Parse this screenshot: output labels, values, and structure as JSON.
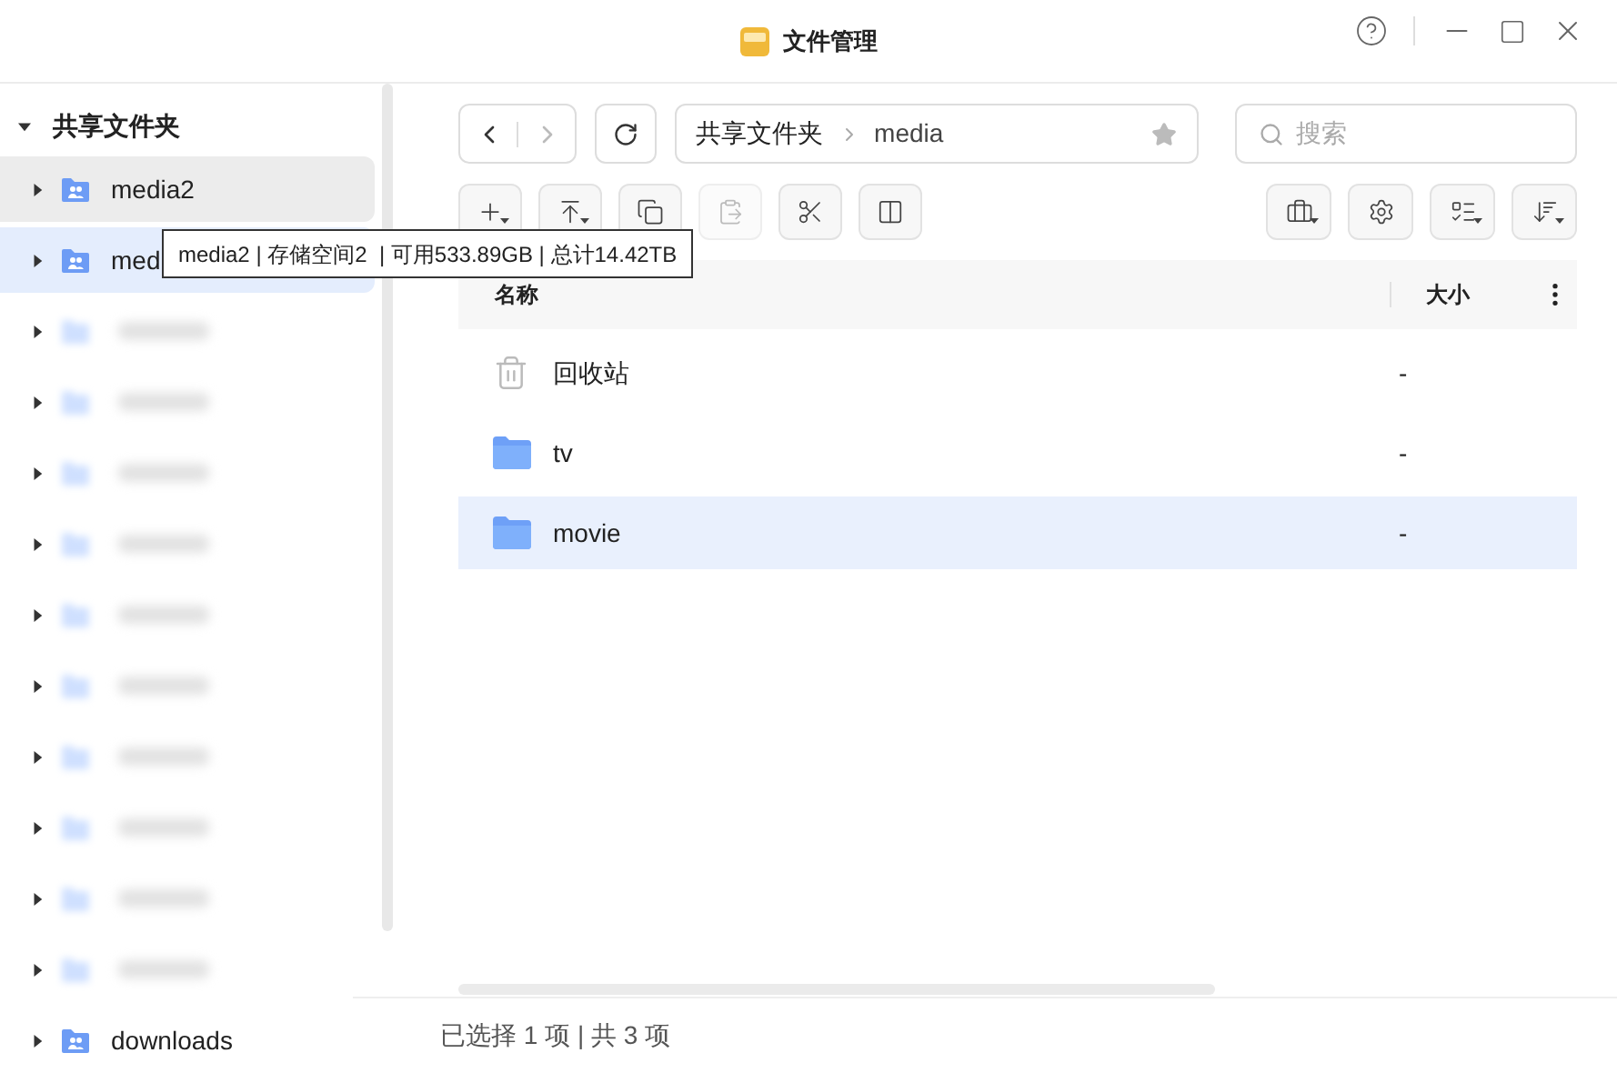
{
  "window": {
    "title": "文件管理"
  },
  "sidebar": {
    "header": "共享文件夹",
    "expanded": true,
    "items": [
      {
        "kind": "share",
        "name": "media2",
        "hovered": true,
        "selected": false
      },
      {
        "kind": "share",
        "name": "med",
        "hovered": false,
        "selected": true
      },
      {
        "kind": "blurred",
        "hovered": false,
        "selected": false
      },
      {
        "kind": "blurred",
        "hovered": false,
        "selected": false
      },
      {
        "kind": "blurred",
        "hovered": false,
        "selected": false
      },
      {
        "kind": "blurred",
        "hovered": false,
        "selected": false
      },
      {
        "kind": "blurred",
        "hovered": false,
        "selected": false
      },
      {
        "kind": "blurred",
        "hovered": false,
        "selected": false
      },
      {
        "kind": "blurred",
        "hovered": false,
        "selected": false
      },
      {
        "kind": "blurred",
        "hovered": false,
        "selected": false
      },
      {
        "kind": "blurred",
        "hovered": false,
        "selected": false
      },
      {
        "kind": "blurred",
        "hovered": false,
        "selected": false
      },
      {
        "kind": "share",
        "name": "downloads",
        "hovered": false,
        "selected": false
      }
    ]
  },
  "tooltip": {
    "text": "media2 | 存储空间2  | 可用533.89GB | 总计14.42TB"
  },
  "nav": {
    "back": {
      "disabled": false
    },
    "forward": {
      "disabled": true
    }
  },
  "breadcrumb": {
    "parts": [
      "共享文件夹",
      "media"
    ],
    "favorite": false
  },
  "search": {
    "placeholder": "搜索"
  },
  "toolbar_left": [
    {
      "kind": "new",
      "disabled": false
    },
    {
      "kind": "upload",
      "disabled": false
    },
    {
      "kind": "copy",
      "disabled": false
    },
    {
      "kind": "paste",
      "disabled": true
    },
    {
      "kind": "cut",
      "disabled": false
    },
    {
      "kind": "move",
      "disabled": false
    }
  ],
  "toolbar_right": [
    {
      "kind": "tools"
    },
    {
      "kind": "settings"
    },
    {
      "kind": "view"
    },
    {
      "kind": "sort"
    }
  ],
  "table": {
    "columns": [
      "名称",
      "大小"
    ],
    "rows": [
      {
        "kind": "trash",
        "name": "回收站",
        "size": "-",
        "selected": false
      },
      {
        "kind": "folder",
        "name": "tv",
        "size": "-",
        "selected": false
      },
      {
        "kind": "folder",
        "name": "movie",
        "size": "-",
        "selected": true
      }
    ]
  },
  "status_bar": "已选择 1 项 | 共 3 项"
}
